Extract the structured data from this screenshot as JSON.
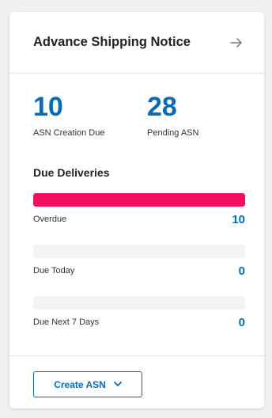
{
  "card": {
    "title": "Advance Shipping Notice",
    "nav_icon": "arrow-right-icon"
  },
  "stats": [
    {
      "value": "10",
      "label": "ASN Creation Due"
    },
    {
      "value": "28",
      "label": "Pending ASN"
    }
  ],
  "deliveries": {
    "title": "Due Deliveries",
    "items": [
      {
        "label": "Overdue",
        "count": "10",
        "fill_fraction": 1.0,
        "bar_color": "#f0105f"
      },
      {
        "label": "Due Today",
        "count": "0",
        "fill_fraction": 0.0,
        "bar_color": "#f0105f"
      },
      {
        "label": "Due Next 7 Days",
        "count": "0",
        "fill_fraction": 0.0,
        "bar_color": "#f0105f"
      }
    ]
  },
  "footer": {
    "create_label": "Create ASN",
    "create_icon": "chevron-down-icon"
  },
  "colors": {
    "accent": "#0a6ab3",
    "overdue": "#f0105f",
    "track": "#f3f3f3"
  }
}
